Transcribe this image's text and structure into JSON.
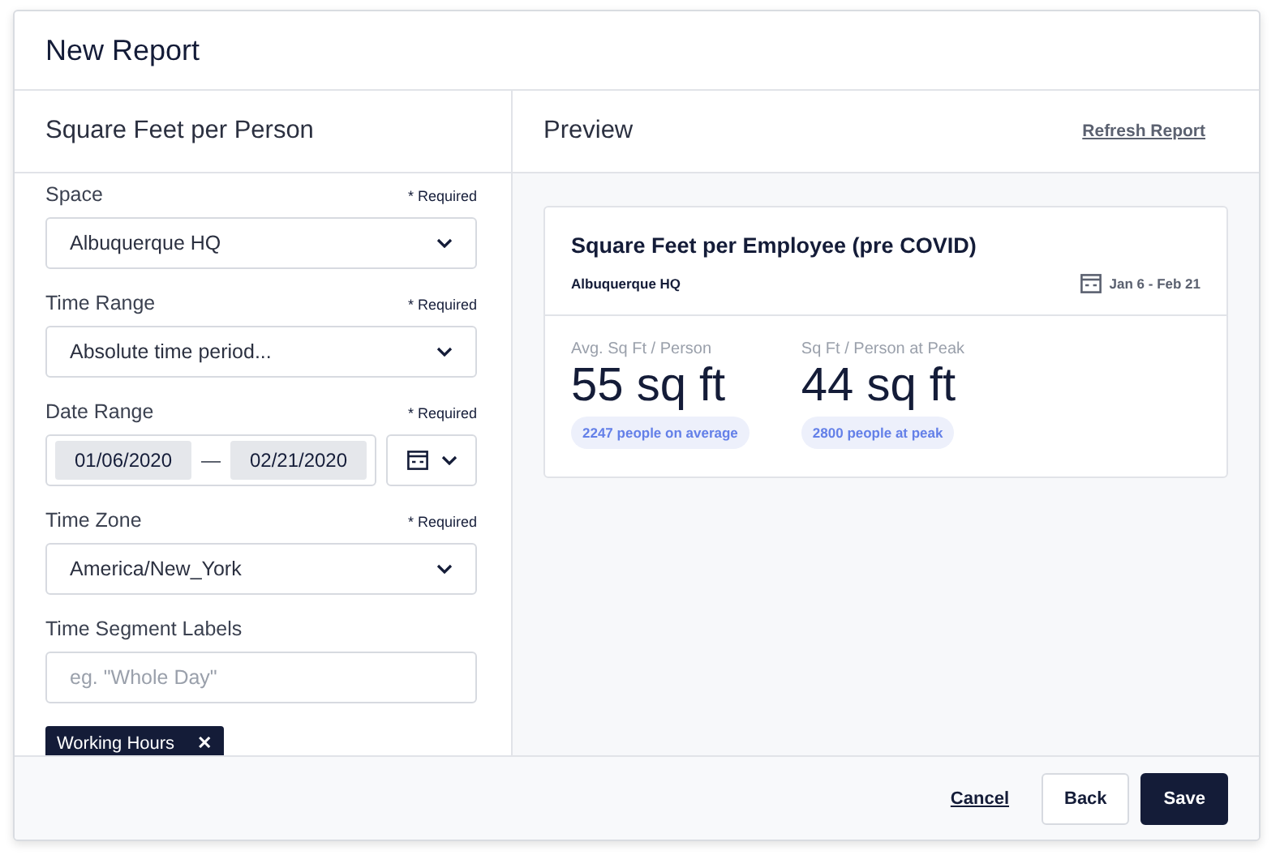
{
  "window": {
    "title": "New Report"
  },
  "form": {
    "title": "Square Feet per Person",
    "fields": [
      {
        "kind": "select",
        "label": "Space",
        "required_note": "* Required",
        "value": "Albuquerque HQ"
      },
      {
        "kind": "select",
        "label": "Time Range",
        "required_note": "* Required",
        "value": "Absolute time period..."
      },
      {
        "kind": "date_range",
        "label": "Date Range",
        "required_note": "* Required",
        "start": "01/06/2020",
        "separator": "—",
        "end": "02/21/2020"
      },
      {
        "kind": "select",
        "label": "Time Zone",
        "required_note": "* Required",
        "value": "America/New_York"
      },
      {
        "kind": "text",
        "label": "Time Segment Labels",
        "placeholder": "eg. \"Whole Day\""
      }
    ],
    "tags": [
      {
        "label": "Working Hours",
        "remove": "✕"
      }
    ]
  },
  "preview": {
    "title": "Preview",
    "refresh_link": "Refresh Report",
    "card": {
      "title": "Square Feet per Employee (pre COVID)",
      "space": "Albuquerque HQ",
      "date_range": "Jan 6 - Feb 21",
      "metrics": [
        {
          "label": "Avg. Sq Ft / Person",
          "value": "55 sq ft",
          "note": "2247 people on average"
        },
        {
          "label": "Sq Ft / Person at Peak",
          "value": "44 sq ft",
          "note": "2800 people at peak"
        }
      ]
    }
  },
  "footer": {
    "buttons": [
      {
        "kind": "link",
        "label": "Cancel"
      },
      {
        "kind": "secondary",
        "label": "Back"
      },
      {
        "kind": "primary",
        "label": "Save"
      }
    ]
  }
}
